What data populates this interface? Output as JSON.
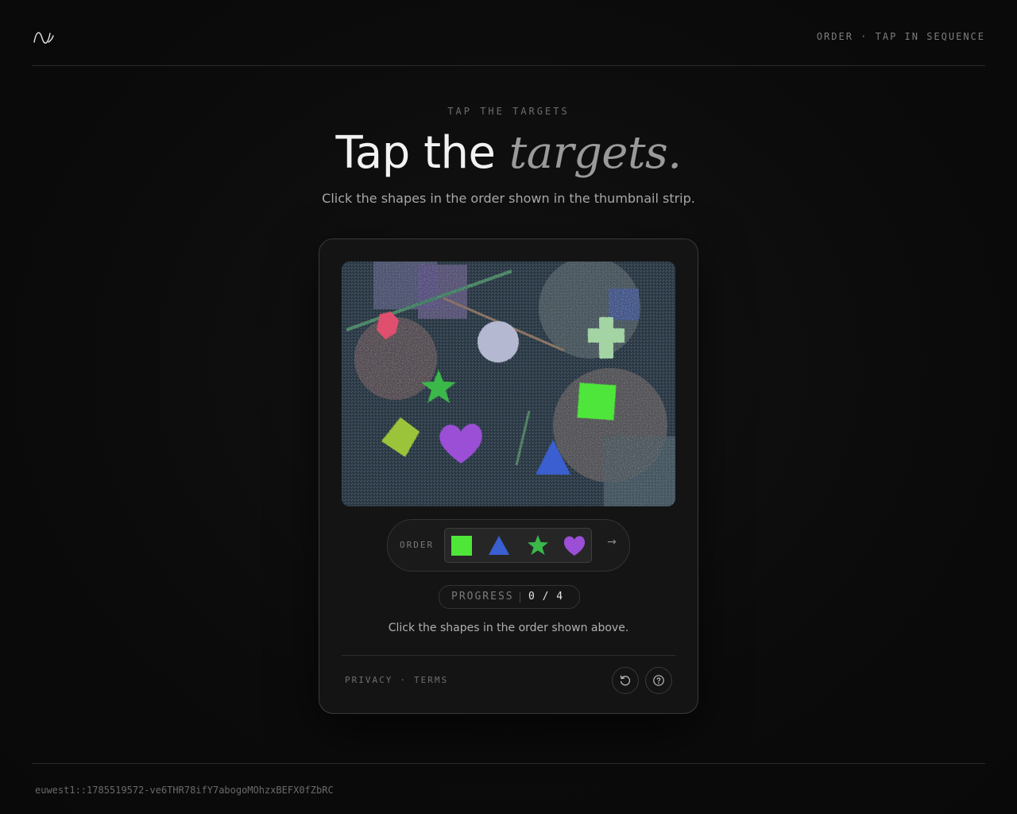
{
  "header": {
    "logo_icon": "wave-logo-icon",
    "tag": "ORDER · TAP IN SEQUENCE"
  },
  "hero": {
    "eyebrow": "TAP THE TARGETS",
    "title_plain": "Tap the ",
    "title_emphasis": "targets.",
    "subtitle": "Click the shapes in the order shown in the thumbnail strip."
  },
  "challenge": {
    "canvas_shapes": [
      "square",
      "triangle",
      "star",
      "heart",
      "cross",
      "circle",
      "diamond",
      "hexagon"
    ],
    "order": {
      "label": "ORDER",
      "sequence": [
        "square",
        "triangle",
        "star",
        "heart"
      ],
      "arrow": "→"
    },
    "progress": {
      "label": "PROGRESS",
      "value": "0 / 4",
      "current": 0,
      "total": 4
    },
    "instruction": "Click the shapes in the order shown above.",
    "footer": {
      "privacy": "PRIVACY",
      "separator": "·",
      "terms": "TERMS",
      "reload_icon": "reload-icon",
      "help_icon": "help-icon"
    }
  },
  "colors": {
    "square": "#4fe63a",
    "triangle": "#3a5fd0",
    "star": "#3ab84a",
    "heart": "#9a4fd6",
    "cross": "#a4d4a4",
    "circle": "#b4b8d0",
    "diamond": "#9cc43a",
    "hexagon": "#e0506e"
  },
  "session_id": "euwest1::1785519572-ve6THR78ifY7abogoMOhzxBEFX0fZbRC"
}
